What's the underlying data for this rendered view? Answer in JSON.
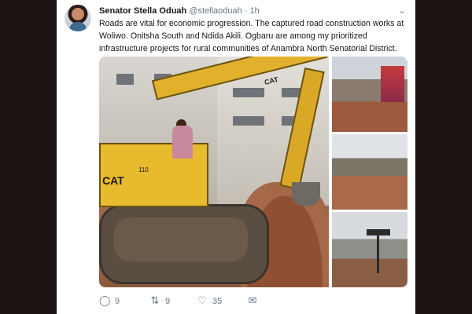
{
  "tweet": {
    "author_name": "Senator Stella Oduah",
    "handle": "@stellaoduah",
    "separator": "·",
    "time": "1h",
    "text": "Roads are vital for economic progression. The captured road construction works at Woliwo. Onitsha South and Ndida Akili. Ogbaru are among my prioritized infrastructure projects for rural communities of Anambra North Senatorial District.",
    "menu_icon": "chevron-down-icon"
  },
  "media": {
    "main_photo_text": {
      "brand": "CAT",
      "model": "110"
    }
  },
  "actions": {
    "replies": "9",
    "retweets": "9",
    "likes": "35",
    "reply_icon": "reply-icon",
    "retweet_icon": "retweet-icon",
    "like_icon": "heart-icon",
    "message_icon": "mail-icon"
  },
  "colors": {
    "background_frame": "#1c1313",
    "card": "#ffffff",
    "secondary_text": "#657786",
    "primary_text": "#14171a"
  }
}
